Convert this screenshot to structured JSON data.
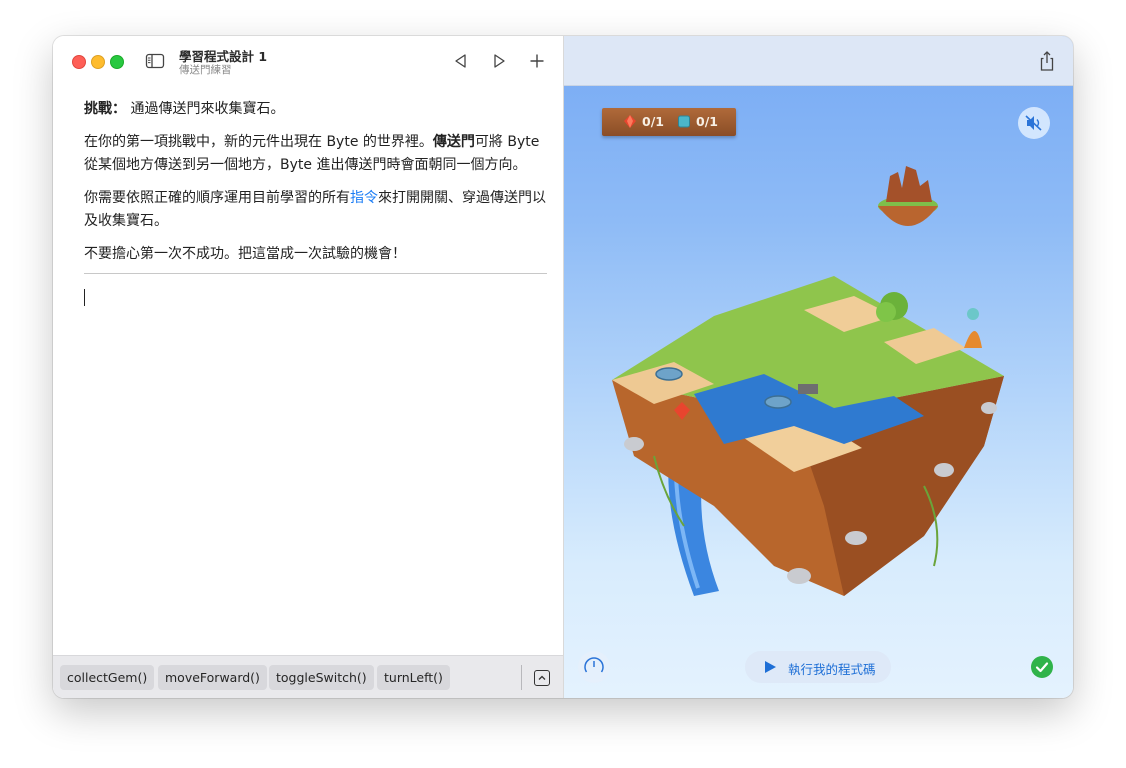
{
  "window": {
    "title": "學習程式設計 1",
    "subtitle": "傳送門練習"
  },
  "instructions": {
    "challenge_label": "挑戰：",
    "challenge_text": "通過傳送門來收集寶石。",
    "p2_a": "在你的第一項挑戰中，新的元件出現在 Byte 的世界裡。",
    "p2_bold": "傳送門",
    "p2_b": "可將 Byte 從某個地方傳送到另一個地方，Byte 進出傳送門時會面朝同一個方向。",
    "p3_a": "你需要依照正確的順序運用目前學習的所有",
    "p3_link": "指令",
    "p3_b": "來打開開關、穿過傳送門以及收集寶石。",
    "p4": "不要擔心第一次不成功。把這當成一次試驗的機會！"
  },
  "shortcut_bar": {
    "chips": [
      "collectGem()",
      "moveForward()",
      "toggleSwitch()",
      "turnLeft()"
    ]
  },
  "scene": {
    "gems_count": "0/1",
    "switches_count": "0/1",
    "run_button_label": "執行我的程式碼"
  },
  "icons": {
    "sidebar": "sidebar-toggle-icon",
    "back": "triangle-left-icon",
    "forward": "triangle-right-icon",
    "add": "plus-icon",
    "share": "share-icon",
    "sound": "speaker-muted-icon",
    "speed": "speedometer-icon",
    "run": "play-icon",
    "complete": "checkmark-circle-icon",
    "expand": "chevron-up-square-icon"
  },
  "colors": {
    "accent": "#1a7cf5",
    "close": "#fe5f57",
    "minimize": "#febc2e",
    "zoom": "#28c840",
    "success": "#30b34a"
  }
}
